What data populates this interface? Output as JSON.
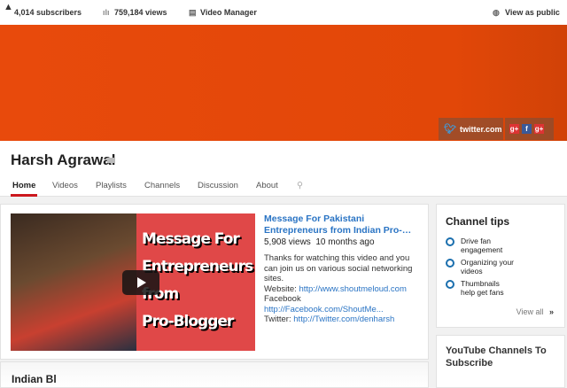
{
  "topbar": {
    "subscribers": "4,014 subscribers",
    "views": "759,184 views",
    "video_manager": "Video Manager",
    "view_as_public": "View as public"
  },
  "banner": {
    "twitter_link": "twitter.com",
    "social_icons": [
      "g+",
      "f",
      "g+"
    ],
    "color": "#e64a0a"
  },
  "channel": {
    "name": "Harsh Agrawal",
    "tabs": [
      "Home",
      "Videos",
      "Playlists",
      "Channels",
      "Discussion",
      "About"
    ],
    "active_tab": "Home"
  },
  "featured_video": {
    "thumbnail_text": [
      "Message For",
      "Entrepreneurs",
      "from",
      "Pro-Blogger"
    ],
    "title": "Message For Pakistani Entrepreneurs from Indian Pro-…",
    "views": "5,908 views",
    "age": "10 months ago",
    "description": "Thanks for watching this video and you can join us on various social networking sites.",
    "website_label": "Website:",
    "website_url": "http://www.shoutmeloud.com",
    "facebook_label": "Facebook",
    "facebook_url": "http://Facebook.com/ShoutMe...",
    "twitter_label": "Twitter:",
    "twitter_url": "http://Twitter.com/denharsh"
  },
  "next_section": {
    "title": "Indian Bl"
  },
  "channel_tips": {
    "title": "Channel tips",
    "items": [
      "Drive fan engagement",
      "Organizing your videos",
      "Thumbnails help get fans"
    ],
    "view_all": "View all"
  },
  "subscribe_box": {
    "title": "YouTube Channels To Subscribe"
  }
}
